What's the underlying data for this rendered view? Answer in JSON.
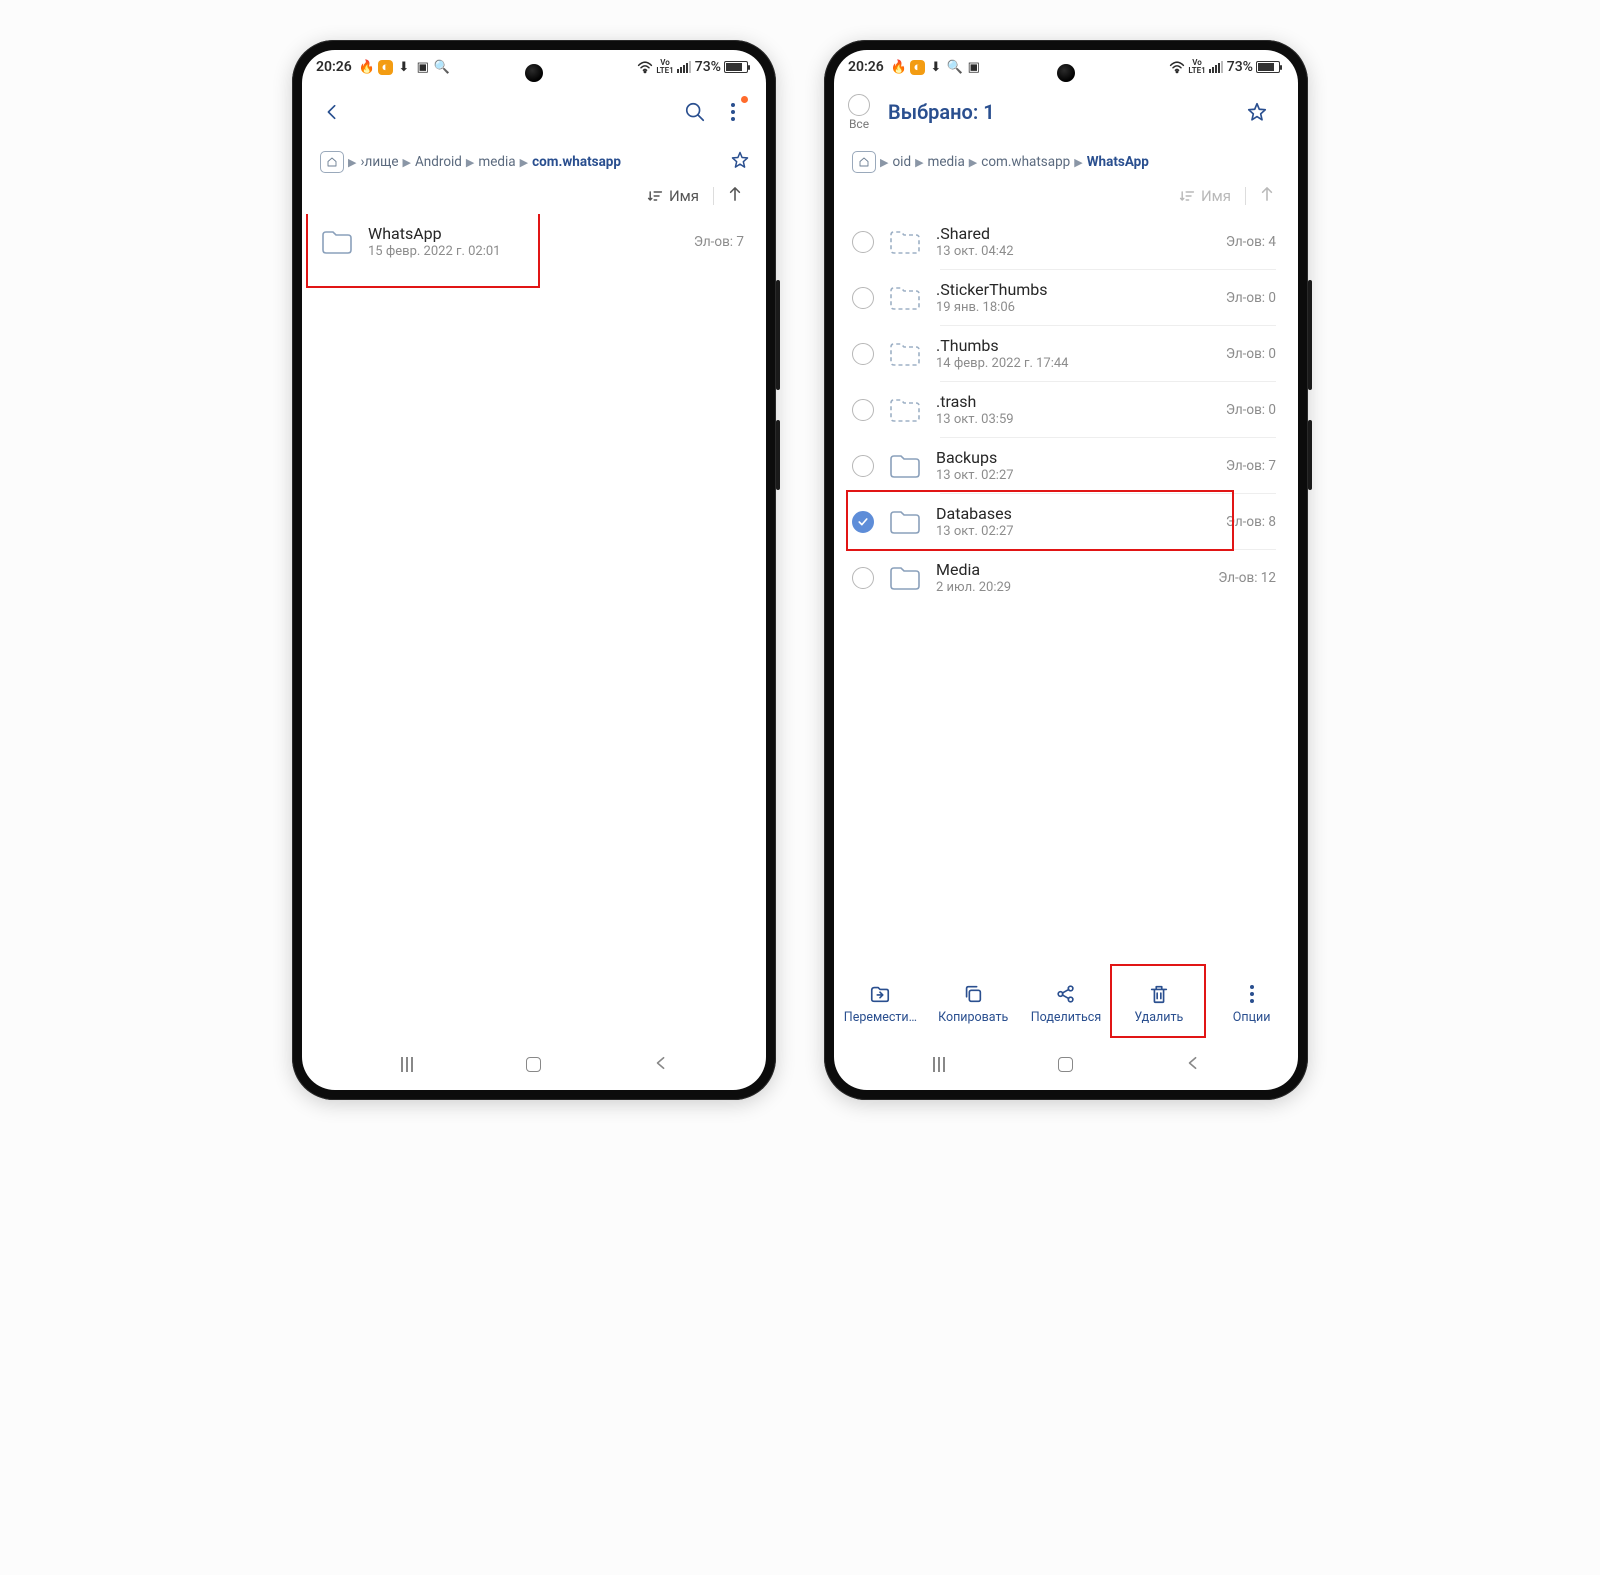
{
  "status": {
    "time": "20:26",
    "battery": "73%",
    "lte": "LTE1",
    "vo": "Vo"
  },
  "left": {
    "breadcrumbs": [
      "›лище",
      "Android",
      "media",
      "com.whatsapp"
    ],
    "sort_label": "Имя",
    "items": [
      {
        "name": "WhatsApp",
        "date": "15 февр. 2022 г. 02:01",
        "count": "Эл-ов: 7"
      }
    ]
  },
  "right": {
    "select_all_label": "Все",
    "title": "Выбрано: 1",
    "breadcrumbs": [
      "oid",
      "media",
      "com.whatsapp",
      "WhatsApp"
    ],
    "sort_label": "Имя",
    "items": [
      {
        "name": ".Shared",
        "date": "13 окт. 04:42",
        "count": "Эл-ов: 4",
        "hidden": true
      },
      {
        "name": ".StickerThumbs",
        "date": "19 янв. 18:06",
        "count": "Эл-ов: 0",
        "hidden": true
      },
      {
        "name": ".Thumbs",
        "date": "14 февр. 2022 г. 17:44",
        "count": "Эл-ов: 0",
        "hidden": true
      },
      {
        "name": ".trash",
        "date": "13 окт. 03:59",
        "count": "Эл-ов: 0",
        "hidden": true
      },
      {
        "name": "Backups",
        "date": "13 окт. 02:27",
        "count": "Эл-ов: 7",
        "hidden": false
      },
      {
        "name": "Databases",
        "date": "13 окт. 02:27",
        "count": "Эл-ов: 8",
        "hidden": false,
        "selected": true
      },
      {
        "name": "Media",
        "date": "2 июл. 20:29",
        "count": "Эл-ов: 12",
        "hidden": false
      }
    ],
    "actions": {
      "move": "Перемести…",
      "copy": "Копировать",
      "share": "Поделиться",
      "delete": "Удалить",
      "options": "Опции"
    }
  }
}
